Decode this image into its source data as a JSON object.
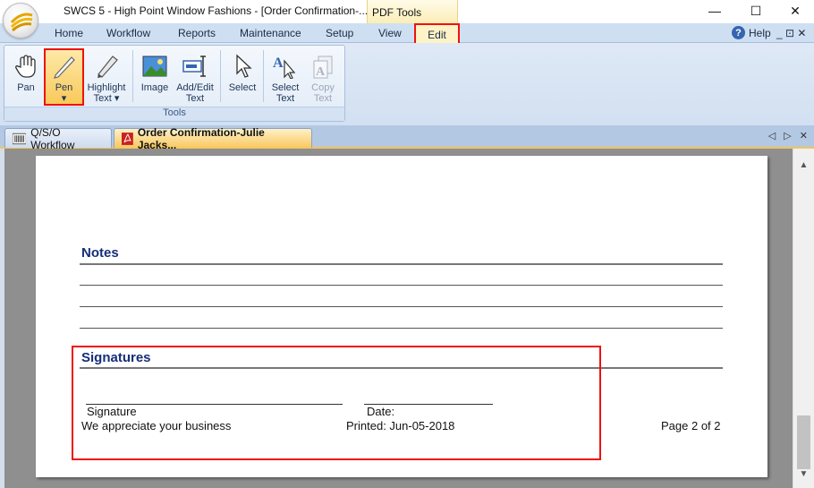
{
  "window": {
    "title": "SWCS 5 - High Point Window Fashions - [Order Confirmation-...",
    "context_tab_header": "PDF Tools",
    "controls": {
      "minimize": "—",
      "maximize": "☐",
      "close": "✕"
    }
  },
  "ribbon_tabs": {
    "home": "Home",
    "workflow": "Workflow",
    "reports": "Reports",
    "maintenance": "Maintenance",
    "setup": "Setup",
    "view": "View",
    "edit": "Edit"
  },
  "help": {
    "icon": "?",
    "label": "Help",
    "mini_controls": "_ ⊡ ✕"
  },
  "tools_group": {
    "label": "Tools",
    "buttons": {
      "pan": {
        "line1": "Pan",
        "line2": ""
      },
      "pen": {
        "line1": "Pen",
        "line2": "▾"
      },
      "highlight": {
        "line1": "Highlight",
        "line2": "Text ▾"
      },
      "image": {
        "line1": "Image",
        "line2": ""
      },
      "add_edit": {
        "line1": "Add/Edit",
        "line2": "Text"
      },
      "select": {
        "line1": "Select",
        "line2": ""
      },
      "select_text": {
        "line1": "Select",
        "line2": "Text"
      },
      "copy_text": {
        "line1": "Copy",
        "line2": "Text"
      }
    }
  },
  "doc_tabs": {
    "workflow_tab": "Q/S/O Workflow",
    "order_tab": "Order Confirmation-Julie Jacks...",
    "nav": "◁ ▷ ✕"
  },
  "document": {
    "notes_heading": "Notes",
    "signatures_heading": "Signatures",
    "signature_label": "Signature",
    "date_label": "Date:",
    "footer_left": "We appreciate your business",
    "footer_center": "Printed: Jun-05-2018",
    "footer_right": "Page 2 of 2"
  },
  "scrollbar": {
    "up": "▲",
    "down": "▼"
  },
  "colors": {
    "heading": "#162d7a",
    "highlight_box": "#ee1111",
    "ribbon": "#dfe9f6",
    "active_doc_tab": "#f9c861"
  }
}
